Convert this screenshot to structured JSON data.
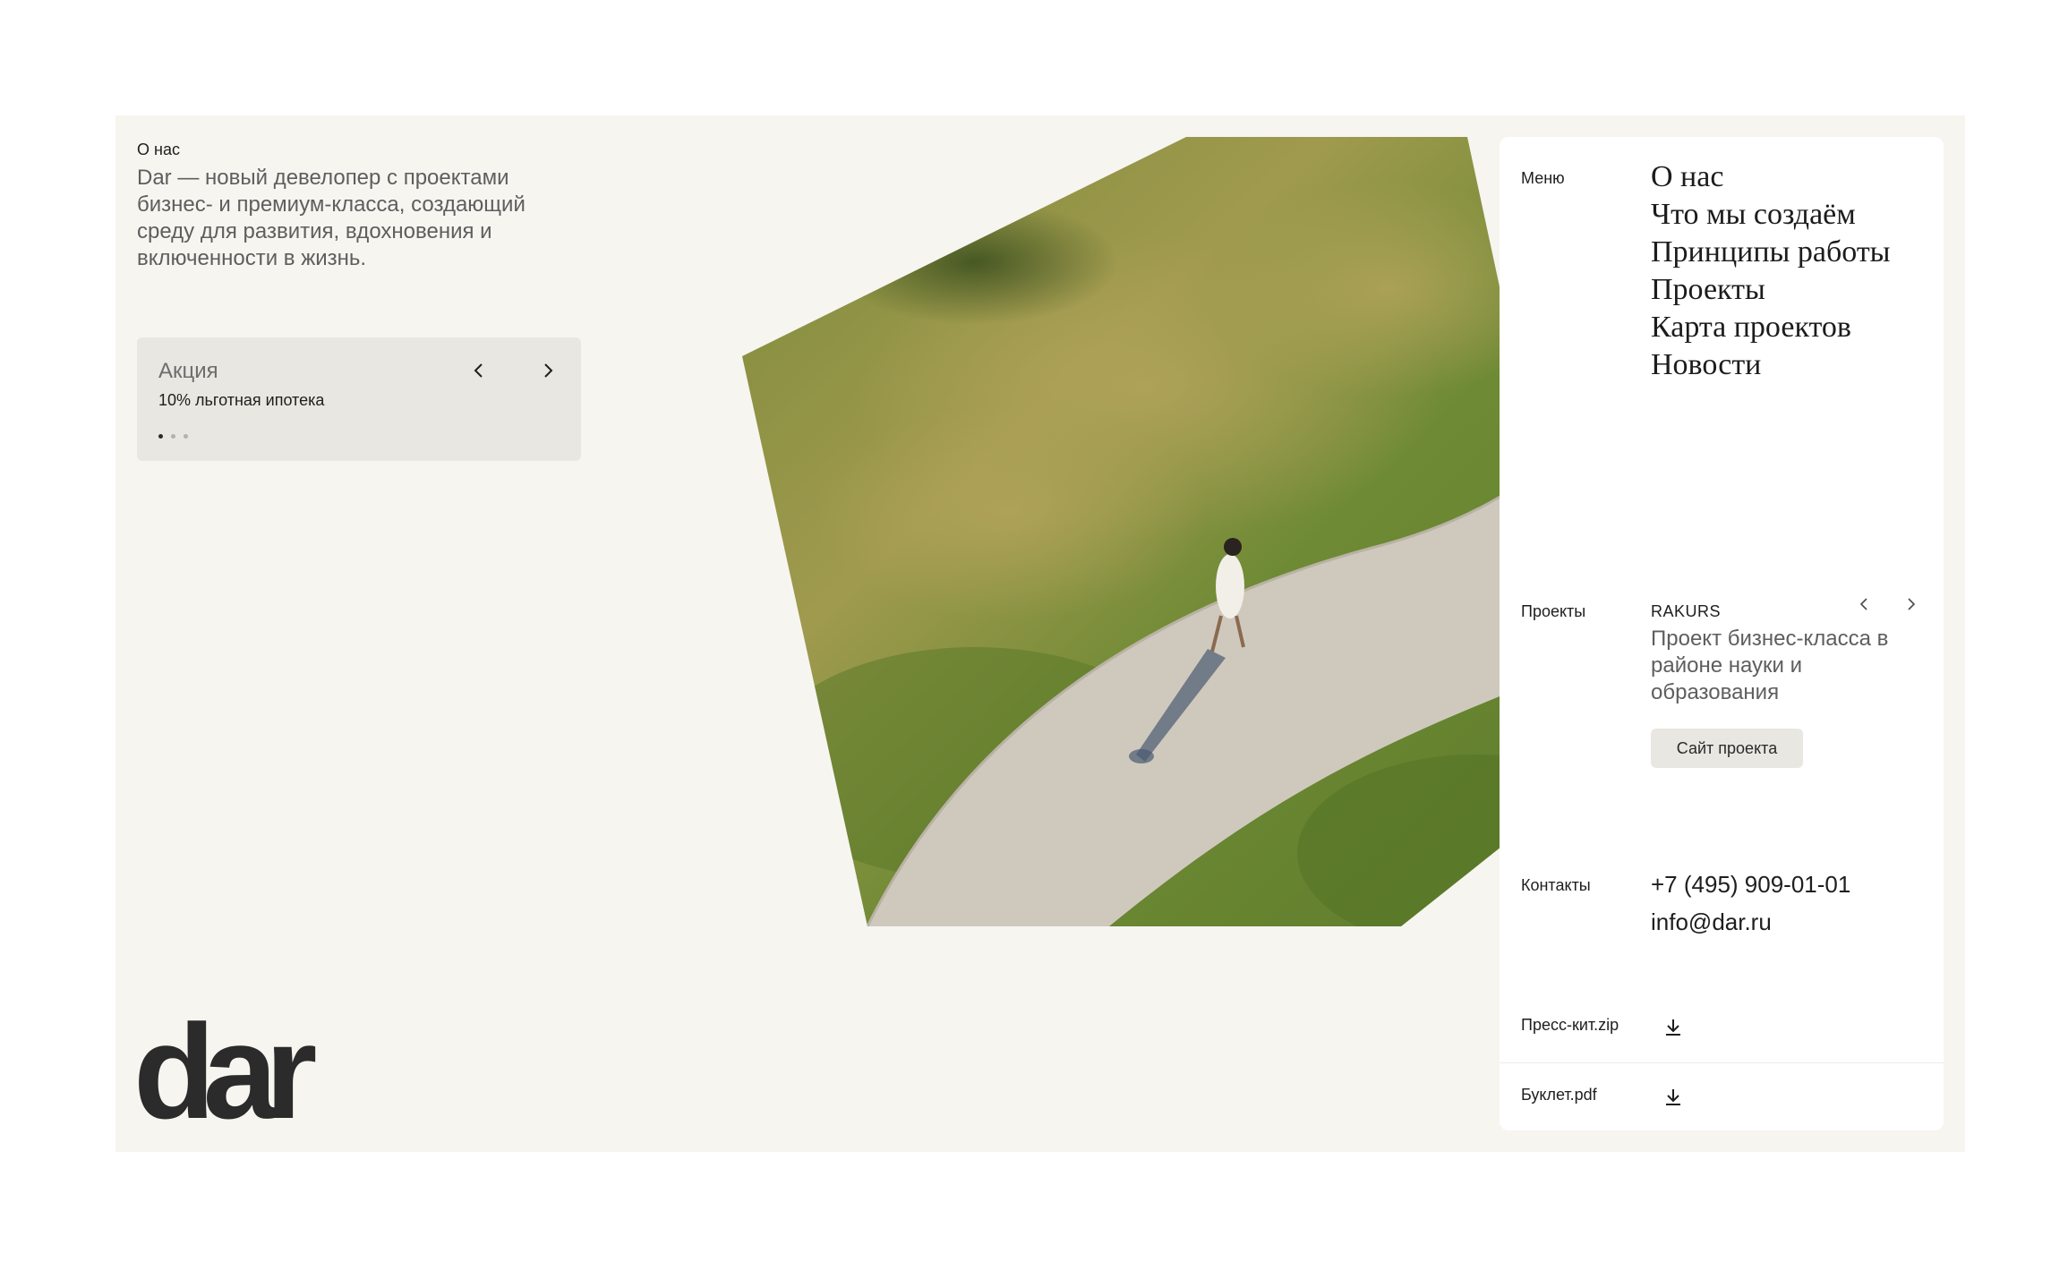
{
  "about": {
    "label": "О нас",
    "text": "Dar — новый девелопер с проектами бизнес- и премиум-класса, создающий среду для развития, вдохновения и включенности в жизнь."
  },
  "promo": {
    "title": "Акция",
    "subtitle": "10% льготная ипотека",
    "prev_icon": "chevron-left-icon",
    "next_icon": "chevron-right-icon",
    "slides_total": 3,
    "active_slide": 1
  },
  "logo": {
    "text": "dar"
  },
  "menu": {
    "label": "Меню",
    "items": [
      {
        "label": "О нас"
      },
      {
        "label": "Что мы создаём"
      },
      {
        "label": "Принципы работы"
      },
      {
        "label": "Проекты"
      },
      {
        "label": "Карта проектов"
      },
      {
        "label": "Новости"
      }
    ]
  },
  "projects": {
    "label": "Проекты",
    "name": "RAKURS",
    "description": "Проект бизнес-класса в районе науки и образования",
    "site_button": "Сайт проекта",
    "prev_icon": "chevron-left-icon",
    "next_icon": "chevron-right-icon"
  },
  "contacts": {
    "label": "Контакты",
    "phone": "+7 (495) 909-01-01",
    "email": "info@dar.ru"
  },
  "downloads": [
    {
      "label": "Пресс-кит.zip",
      "icon": "download-icon"
    },
    {
      "label": "Буклет.pdf",
      "icon": "download-icon"
    }
  ],
  "colors": {
    "page_bg": "#ffffff",
    "frame_bg": "#f6f5f0",
    "card_bg": "#e9e7e1",
    "text_dark": "#1e1e1e",
    "text_muted": "#5e5e5e"
  }
}
